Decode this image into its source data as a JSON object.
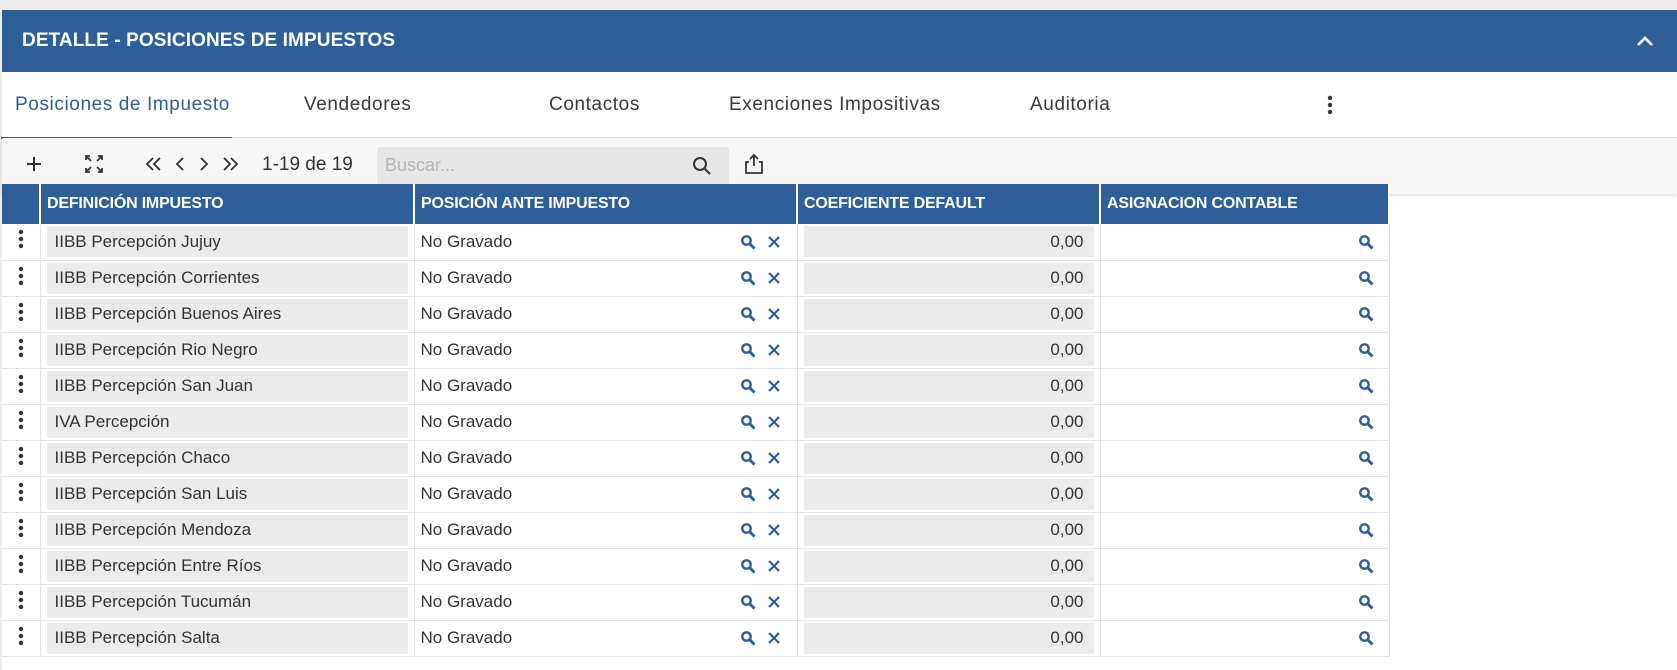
{
  "panel": {
    "title": "DETALLE - POSICIONES DE IMPUESTOS"
  },
  "tabs": [
    {
      "label": "Posiciones de Impuesto",
      "active": true
    },
    {
      "label": "Vendedores",
      "active": false
    },
    {
      "label": "Contactos",
      "active": false
    },
    {
      "label": "Exenciones Impositivas",
      "active": false
    },
    {
      "label": "Auditoria",
      "active": false
    }
  ],
  "toolbar": {
    "page_info": "1-19 de 19",
    "search_placeholder": "Buscar..."
  },
  "grid": {
    "columns": [
      "DEFINICIÓN IMPUESTO",
      "POSICIÓN ANTE IMPUESTO",
      "COEFICIENTE DEFAULT",
      "ASIGNACION CONTABLE"
    ],
    "rows": [
      {
        "definicion": "IIBB Percepción Jujuy",
        "posicion": "No Gravado",
        "coeficiente": "0,00",
        "asignacion": ""
      },
      {
        "definicion": "IIBB Percepción Corrientes",
        "posicion": "No Gravado",
        "coeficiente": "0,00",
        "asignacion": ""
      },
      {
        "definicion": "IIBB Percepción Buenos Aires",
        "posicion": "No Gravado",
        "coeficiente": "0,00",
        "asignacion": ""
      },
      {
        "definicion": "IIBB Percepción Rio Negro",
        "posicion": "No Gravado",
        "coeficiente": "0,00",
        "asignacion": ""
      },
      {
        "definicion": "IIBB Percepción San Juan",
        "posicion": "No Gravado",
        "coeficiente": "0,00",
        "asignacion": ""
      },
      {
        "definicion": "IVA Percepción",
        "posicion": "No Gravado",
        "coeficiente": "0,00",
        "asignacion": ""
      },
      {
        "definicion": "IIBB Percepción Chaco",
        "posicion": "No Gravado",
        "coeficiente": "0,00",
        "asignacion": ""
      },
      {
        "definicion": "IIBB Percepción San Luis",
        "posicion": "No Gravado",
        "coeficiente": "0,00",
        "asignacion": ""
      },
      {
        "definicion": "IIBB Percepción Mendoza",
        "posicion": "No Gravado",
        "coeficiente": "0,00",
        "asignacion": ""
      },
      {
        "definicion": "IIBB Percepción Entre Ríos",
        "posicion": "No Gravado",
        "coeficiente": "0,00",
        "asignacion": ""
      },
      {
        "definicion": "IIBB Percepción Tucumán",
        "posicion": "No Gravado",
        "coeficiente": "0,00",
        "asignacion": ""
      },
      {
        "definicion": "IIBB Percepción Salta",
        "posicion": "No Gravado",
        "coeficiente": "0,00",
        "asignacion": ""
      }
    ]
  },
  "icons": {
    "collapse": "chevron-up-icon",
    "tabs_more": "more-vertical-icon",
    "add": "plus-icon",
    "expand": "fullscreen-icon",
    "first": "first-page-icon",
    "prev": "chevron-left-icon",
    "next": "chevron-right-icon",
    "last": "last-page-icon",
    "search": "search-icon",
    "export": "export-icon",
    "row_menu": "more-vertical-icon",
    "lookup": "search-icon",
    "clear": "close-icon"
  },
  "colors": {
    "brand": "#2f5f98",
    "readonly_cell": "#ebebeb"
  }
}
